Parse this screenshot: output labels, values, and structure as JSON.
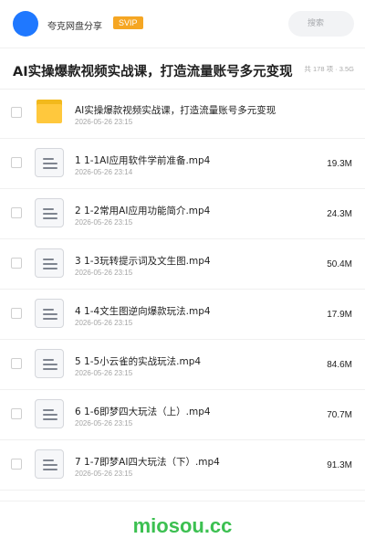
{
  "header": {
    "app_name": "夸克网盘分享",
    "badge": "SVIP",
    "search_placeholder": "搜索"
  },
  "folder": {
    "title": "AI实操爆款视频实战课，打造流量账号多元变现",
    "meta": "共 178 项 · 3.5G"
  },
  "items": [
    {
      "type": "folder",
      "name": "AI实操爆款视频实战课，打造流量账号多元变现",
      "date": "2026-05-26 23:15",
      "size": ""
    },
    {
      "type": "file",
      "name": "1 1-1AI应用软件学前准备.mp4",
      "date": "2026-05-26 23:14",
      "size": "19.3M"
    },
    {
      "type": "file",
      "name": "2 1-2常用AI应用功能简介.mp4",
      "date": "2026-05-26 23:15",
      "size": "24.3M"
    },
    {
      "type": "file",
      "name": "3 1-3玩转提示词及文生图.mp4",
      "date": "2026-05-26 23:15",
      "size": "50.4M"
    },
    {
      "type": "file",
      "name": "4 1-4文生图逆向爆款玩法.mp4",
      "date": "2026-05-26 23:15",
      "size": "17.9M"
    },
    {
      "type": "file",
      "name": "5 1-5小云雀的实战玩法.mp4",
      "date": "2026-05-26 23:15",
      "size": "84.6M"
    },
    {
      "type": "file",
      "name": "6 1-6即梦四大玩法（上）.mp4",
      "date": "2026-05-26 23:15",
      "size": "70.7M"
    },
    {
      "type": "file",
      "name": "7 1-7即梦AI四大玩法（下）.mp4",
      "date": "2026-05-26 23:15",
      "size": "91.3M"
    }
  ],
  "watermark": "miosou.cc",
  "colors": {
    "accent": "#1f78ff",
    "badge": "#f5a623",
    "folder": "#ffc83d",
    "watermark": "#3cc051"
  }
}
